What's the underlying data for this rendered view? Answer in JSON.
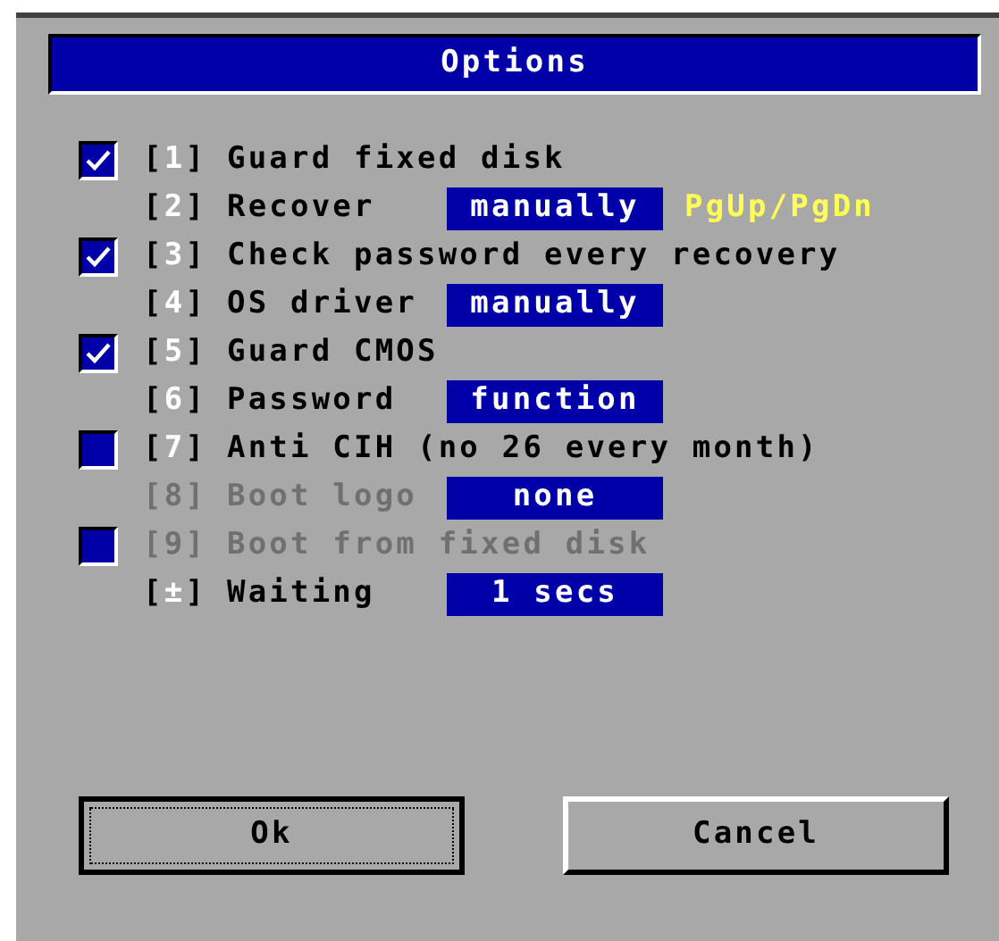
{
  "window": {
    "title": "Options"
  },
  "key_brackets": [
    "[",
    "]"
  ],
  "rows": [
    {
      "kind": "checkbox",
      "checked": true,
      "disabled": false,
      "key": "1",
      "label": "Guard fixed disk"
    },
    {
      "kind": "option",
      "disabled": false,
      "key": "2",
      "label": "Recover",
      "value": "manually",
      "hint": "PgUp/PgDn"
    },
    {
      "kind": "checkbox",
      "checked": true,
      "disabled": false,
      "key": "3",
      "label": "Check password every recovery"
    },
    {
      "kind": "option",
      "disabled": false,
      "key": "4",
      "label": "OS driver",
      "value": "manually"
    },
    {
      "kind": "checkbox",
      "checked": true,
      "disabled": false,
      "key": "5",
      "label": "Guard CMOS"
    },
    {
      "kind": "option",
      "disabled": false,
      "key": "6",
      "label": "Password",
      "value": "function"
    },
    {
      "kind": "checkbox",
      "checked": false,
      "disabled": false,
      "key": "7",
      "label": "Anti CIH (no 26 every month)"
    },
    {
      "kind": "option",
      "disabled": true,
      "key": "8",
      "label": "Boot logo",
      "value": "none"
    },
    {
      "kind": "checkbox",
      "checked": false,
      "disabled": true,
      "key": "9",
      "label": "Boot from fixed disk"
    },
    {
      "kind": "option",
      "disabled": false,
      "key": "±",
      "label": "Waiting",
      "value": "1 secs"
    }
  ],
  "buttons": [
    {
      "label": "Ok",
      "focused": true
    },
    {
      "label": "Cancel",
      "focused": false
    }
  ]
}
